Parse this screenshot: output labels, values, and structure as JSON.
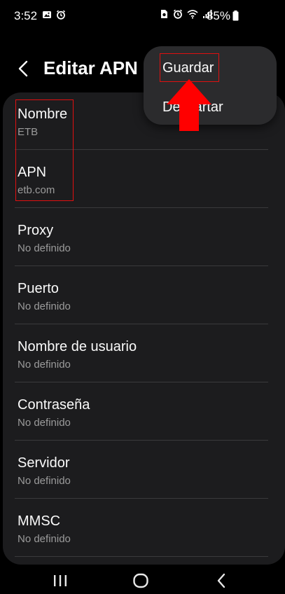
{
  "status_bar": {
    "time": "3:52",
    "battery": "85%",
    "left_icons": [
      "image-icon",
      "alarm-icon"
    ],
    "right_icons": [
      "sim-icon",
      "alarm-icon",
      "wifi-icon",
      "signal-icon",
      "battery-icon"
    ]
  },
  "header": {
    "back_icon": "chevron-left-icon",
    "title": "Editar APN"
  },
  "menu": {
    "items": [
      {
        "label": "Guardar"
      },
      {
        "label": "Descartar"
      }
    ]
  },
  "fields": [
    {
      "label": "Nombre",
      "value": "ETB"
    },
    {
      "label": "APN",
      "value": "etb.com"
    },
    {
      "label": "Proxy",
      "value": "No definido"
    },
    {
      "label": "Puerto",
      "value": "No definido"
    },
    {
      "label": "Nombre de usuario",
      "value": "No definido"
    },
    {
      "label": "Contraseña",
      "value": "No definido"
    },
    {
      "label": "Servidor",
      "value": "No definido"
    },
    {
      "label": "MMSC",
      "value": "No definido"
    }
  ],
  "annotations": {
    "highlight_color": "#e01010",
    "arrow_color": "#ff0000"
  },
  "nav_bar": {
    "buttons": [
      "recents-icon",
      "home-icon",
      "back-icon"
    ]
  }
}
